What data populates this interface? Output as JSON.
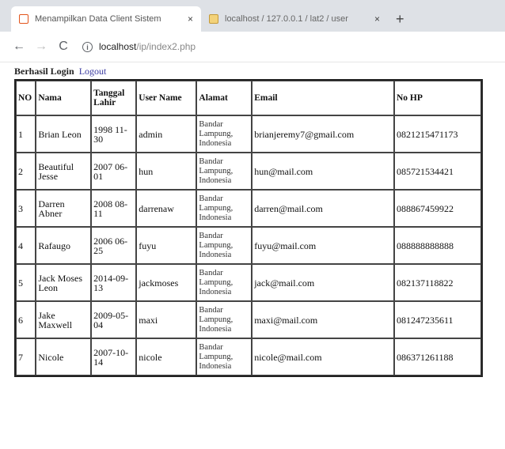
{
  "browser": {
    "tabs": [
      {
        "title": "Menampilkan Data Client Sistem",
        "active": true
      },
      {
        "title": "localhost / 127.0.0.1 / lat2 / user",
        "active": false
      }
    ],
    "close_glyph": "×",
    "new_tab_glyph": "+",
    "back_glyph": "←",
    "forward_glyph": "→",
    "reload_glyph": "C",
    "url_host": "localhost",
    "url_path": "/ip/index2.php"
  },
  "page": {
    "login_text": "Berhasil Login",
    "logout_link": "Logout"
  },
  "table": {
    "headers": [
      "NO",
      "Nama",
      "Tanggal Lahir",
      "User Name",
      "Alamat",
      "Email",
      "No HP"
    ],
    "rows": [
      {
        "no": "1",
        "nama": "Brian Leon",
        "tgl": "1998 11-30",
        "user": "admin",
        "alamat": "Bandar Lampung, Indonesia",
        "email": "brianjeremy7@gmail.com",
        "hp": "0821215471173"
      },
      {
        "no": "2",
        "nama": "Beautiful Jesse",
        "tgl": "2007 06-01",
        "user": "hun",
        "alamat": "Bandar Lampung, Indonesia",
        "email": "hun@mail.com",
        "hp": "085721534421"
      },
      {
        "no": "3",
        "nama": "Darren Abner",
        "tgl": "2008 08-11",
        "user": "darrenaw",
        "alamat": "Bandar Lampung, Indonesia",
        "email": "darren@mail.com",
        "hp": "088867459922"
      },
      {
        "no": "4",
        "nama": "Rafaugo",
        "tgl": "2006 06-25",
        "user": "fuyu",
        "alamat": "Bandar Lampung, Indonesia",
        "email": "fuyu@mail.com",
        "hp": "088888888888"
      },
      {
        "no": "5",
        "nama": "Jack Moses Leon",
        "tgl": "2014-09-13",
        "user": "jackmoses",
        "alamat": "Bandar Lampung, Indonesia",
        "email": "jack@mail.com",
        "hp": "082137118822"
      },
      {
        "no": "6",
        "nama": "Jake Maxwell",
        "tgl": "2009-05-04",
        "user": "maxi",
        "alamat": "Bandar Lampung, Indonesia",
        "email": "maxi@mail.com",
        "hp": "081247235611"
      },
      {
        "no": "7",
        "nama": "Nicole",
        "tgl": "2007-10-14",
        "user": "nicole",
        "alamat": "Bandar Lampung, Indonesia",
        "email": "nicole@mail.com",
        "hp": "086371261188"
      }
    ]
  }
}
